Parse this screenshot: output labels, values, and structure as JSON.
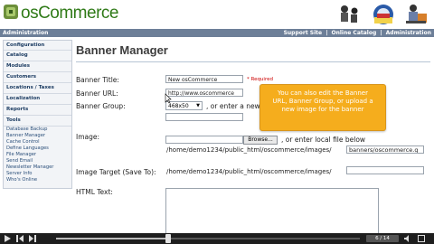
{
  "header": {
    "logo_text": "osCommerce",
    "icons": [
      "customers-icon",
      "orders-icon",
      "tools-icon"
    ]
  },
  "navbar": {
    "left": "Administration",
    "links": [
      "Support Site",
      "|",
      "Online Catalog",
      "|",
      "Administration"
    ]
  },
  "sidebar": {
    "sections": [
      "Configuration",
      "Catalog",
      "Modules",
      "Customers",
      "Locations / Taxes",
      "Localization",
      "Reports",
      "Tools"
    ],
    "tools_items": [
      "Database Backup",
      "Banner Manager",
      "Cache Control",
      "Define Languages",
      "File Manager",
      "Send Email",
      "Newsletter Manager",
      "Server Info",
      "Who's Online"
    ]
  },
  "page": {
    "title": "Banner Manager"
  },
  "form": {
    "banner_title_label": "Banner Title:",
    "banner_title_value": "New osCommerce",
    "required_text": "* Required",
    "banner_url_label": "Banner URL:",
    "banner_url_value": "http://www.oscommerce",
    "banner_group_label": "Banner Group:",
    "banner_group_value": "468x50",
    "or_enter_new": ", or enter a new",
    "image_label": "Image:",
    "browse_label": "Browse...",
    "or_enter_local": ", or enter local file below",
    "image_path": "/home/demo1234/public_html/oscommerce/images/",
    "image_path_value": "banners/oscommerce.g",
    "image_target_label": "Image Target (Save To):",
    "image_target_path": "/home/demo1234/public_html/oscommerce/images/",
    "html_text_label": "HTML Text:"
  },
  "tooltip": {
    "text": "You can also edit the Banner URL, Banner Group, or upload a new image for the banner"
  },
  "player": {
    "counter": "6 / 14",
    "progress": 0.37
  },
  "colors": {
    "accent_green": "#2f7a17",
    "navbar": "#6d7f98",
    "tooltip": "#f5ad1d"
  }
}
